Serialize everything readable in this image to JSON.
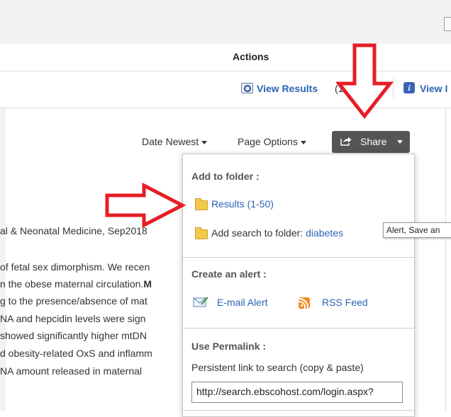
{
  "actions": {
    "heading": "Actions",
    "view_results_label": "View Results",
    "view_results_count": "(109,229)",
    "view_details_label": "View I"
  },
  "toolbar": {
    "date_sort": "Date Newest",
    "page_options": "Page Options",
    "share": "Share"
  },
  "share_menu": {
    "add_to_folder_heading": "Add to folder :",
    "results_folder_link": "Results (1-50)",
    "add_search_label": "Add search to folder:",
    "add_search_term": "diabetes",
    "create_alert_heading": "Create an alert :",
    "email_alert": "E-mail Alert",
    "rss_feed": "RSS Feed",
    "permalink_heading": "Use Permalink :",
    "permalink_desc": "Persistent link to search (copy & paste)",
    "permalink_value": "http://search.ebscohost.com/login.aspx?"
  },
  "tooltip": "Alert, Save an",
  "background_text": {
    "source": "al & Neonatal Medicine, Sep2018",
    "abstract_lines": [
      "of fetal sex dimorphism. We recen",
      "n the obese maternal circulation.",
      "g to the presence/absence of mat",
      "NA and hepcidin levels were sign",
      " showed significantly higher mtDN",
      "d obesity-related OxS and inflamm",
      "NA amount released in maternal"
    ],
    "bold_fragment": "M"
  },
  "colors": {
    "link": "#2a64b5",
    "share_button_bg": "#555555",
    "arrow_red": "#e51e25",
    "topbar_bg": "#f2f2f2"
  }
}
